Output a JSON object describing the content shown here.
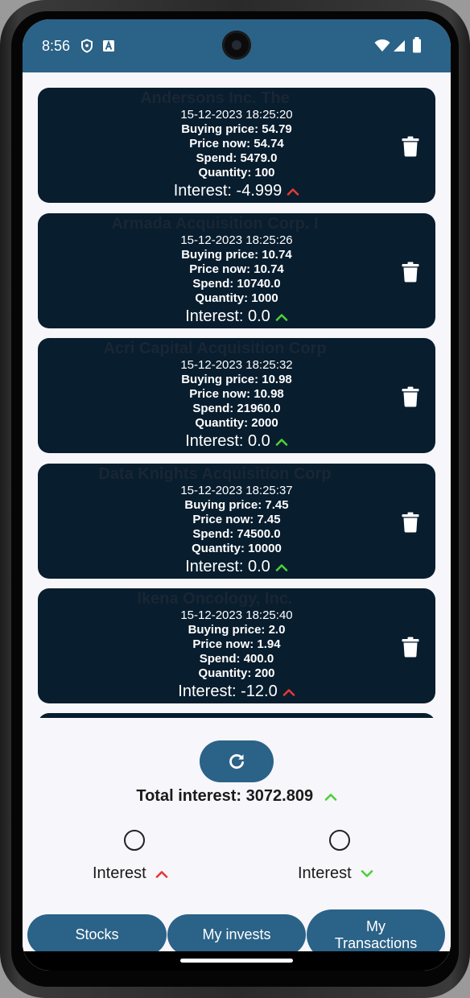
{
  "status_bar": {
    "time": "8:56"
  },
  "cards": [
    {
      "name": "Andersons Inc. The",
      "date": "15-12-2023 18:25:20",
      "buying": "Buying price: 54.79",
      "now": "Price now: 54.74",
      "spend": "Spend: 5479.0",
      "quantity": "Quantity: 100",
      "interest": "Interest: -4.999",
      "trend": "up",
      "trend_color": "#e53935"
    },
    {
      "name": "Armada Acquisition Corp. I",
      "date": "15-12-2023 18:25:26",
      "buying": "Buying price: 10.74",
      "now": "Price now: 10.74",
      "spend": "Spend: 10740.0",
      "quantity": "Quantity: 1000",
      "interest": "Interest: 0.0",
      "trend": "up",
      "trend_color": "#4cd137"
    },
    {
      "name": "Acri Capital Acquisition Corp",
      "date": "15-12-2023 18:25:32",
      "buying": "Buying price: 10.98",
      "now": "Price now: 10.98",
      "spend": "Spend: 21960.0",
      "quantity": "Quantity: 2000",
      "interest": "Interest: 0.0",
      "trend": "up",
      "trend_color": "#4cd137"
    },
    {
      "name": "Data Knights Acquisition Corp",
      "date": "15-12-2023 18:25:37",
      "buying": "Buying price: 7.45",
      "now": "Price now: 7.45",
      "spend": "Spend: 74500.0",
      "quantity": "Quantity: 10000",
      "interest": "Interest: 0.0",
      "trend": "up",
      "trend_color": "#4cd137"
    },
    {
      "name": "Ikena Oncology, Inc.",
      "date": "15-12-2023 18:25:40",
      "buying": "Buying price: 2.0",
      "now": "Price now: 1.94",
      "spend": "Spend: 400.0",
      "quantity": "Quantity: 200",
      "interest": "Interest: -12.0",
      "trend": "up",
      "trend_color": "#e53935"
    }
  ],
  "total": {
    "label": "Total interest: 3072.809",
    "trend_color": "#4cd137"
  },
  "sort": [
    {
      "label": "Interest",
      "direction": "up",
      "color": "#e53935"
    },
    {
      "label": "Interest",
      "direction": "down",
      "color": "#4cd137"
    }
  ],
  "nav": {
    "stocks": "Stocks",
    "my_invests": "My invests",
    "my_transactions": "My Transactions"
  },
  "colors": {
    "primary": "#2b6287",
    "card_bg": "#081d2e",
    "background": "#f7f6fb"
  },
  "icons": {
    "refresh": "refresh-icon",
    "delete": "trash-icon"
  }
}
